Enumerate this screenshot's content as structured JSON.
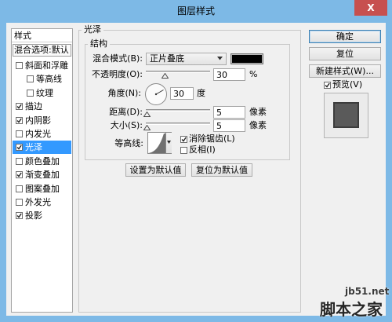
{
  "window": {
    "title": "图层样式",
    "close_label": "X"
  },
  "sidebar": {
    "header": "样式",
    "blend_options": "混合选项:默认",
    "items": [
      {
        "label": "斜面和浮雕",
        "checked": false
      },
      {
        "label": "等高线",
        "checked": false
      },
      {
        "label": "纹理",
        "checked": false
      },
      {
        "label": "描边",
        "checked": true
      },
      {
        "label": "内阴影",
        "checked": true
      },
      {
        "label": "内发光",
        "checked": false
      },
      {
        "label": "光泽",
        "checked": true,
        "selected": true
      },
      {
        "label": "颜色叠加",
        "checked": false
      },
      {
        "label": "渐变叠加",
        "checked": true
      },
      {
        "label": "图案叠加",
        "checked": false
      },
      {
        "label": "外发光",
        "checked": false
      },
      {
        "label": "投影",
        "checked": true
      }
    ]
  },
  "panel": {
    "title": "光泽",
    "structure": {
      "title": "结构",
      "blend_mode_label": "混合模式(B):",
      "blend_mode_value": "正片叠底",
      "color": "#000000",
      "opacity_label": "不透明度(O):",
      "opacity_value": "30",
      "opacity_unit": "%",
      "angle_label": "角度(N):",
      "angle_value": "30",
      "angle_unit": "度",
      "distance_label": "距离(D):",
      "distance_value": "5",
      "distance_unit": "像素",
      "size_label": "大小(S):",
      "size_value": "5",
      "size_unit": "像素",
      "contour_label": "等高线:",
      "anti_alias_label": "消除锯齿(L)",
      "anti_alias_checked": true,
      "invert_label": "反相(I)",
      "invert_checked": false
    },
    "set_default_label": "设置为默认值",
    "reset_default_label": "复位为默认值"
  },
  "actions": {
    "ok_label": "确定",
    "reset_label": "复位",
    "new_style_label": "新建样式(W)...",
    "preview_label": "预览(V)",
    "preview_checked": true
  },
  "watermark": {
    "site": "jb51.net",
    "name": "脚本之家"
  }
}
